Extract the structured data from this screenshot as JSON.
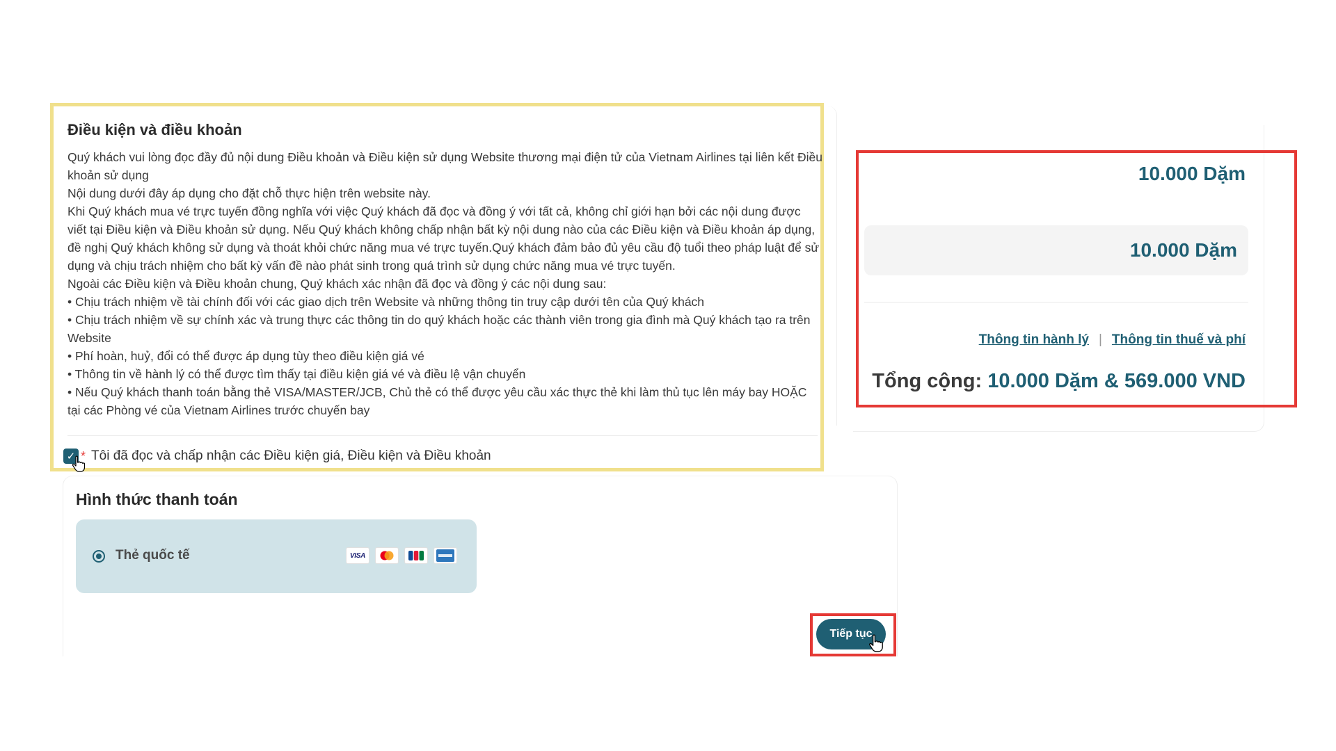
{
  "terms": {
    "title": "Điều kiện và điều khoản",
    "paragraphs": [
      "Quý khách vui lòng đọc đầy đủ nội dung Điều khoản và Điều kiện sử dụng Website thương mại điện tử của Vietnam Airlines tại liên kết Điều khoản sử dụng",
      "Nội dung dưới đây áp dụng cho đặt chỗ thực hiện trên website này.",
      "Khi Quý khách mua vé trực tuyến đồng nghĩa với việc Quý khách đã đọc và đồng ý với tất cả, không chỉ giới hạn bởi các nội dung được viết tại Điều kiện và Điều khoản sử dụng. Nếu Quý khách không chấp nhận bất kỳ nội dung nào của các Điều kiện và Điều khoản áp dụng, đề nghị Quý khách không sử dụng và thoát khỏi chức năng mua vé trực tuyến.Quý khách đảm bảo đủ yêu cầu độ tuổi theo pháp luật để sử dụng và chịu trách nhiệm cho bất kỳ vấn đề nào phát sinh trong quá trình sử dụng chức năng mua vé trực tuyến.",
      "Ngoài các Điều kiện và Điều khoản chung, Quý khách xác nhận đã đọc và đồng ý các nội dung sau:",
      "• Chịu trách nhiệm về tài chính đối với các giao dịch trên Website và những thông tin truy cập dưới tên của Quý khách",
      "• Chịu trách nhiệm về sự chính xác và trung thực các thông tin do quý khách hoặc các thành viên trong gia đình mà Quý khách tạo ra trên Website",
      "• Phí hoàn, huỷ, đổi có thể được áp dụng tùy theo điều kiện giá vé",
      "• Thông tin về hành lý có thể được tìm thấy tại điều kiện giá vé và điều lệ vận chuyển",
      "• Nếu Quý khách thanh toán bằng thẻ VISA/MASTER/JCB, Chủ thẻ có thể được yêu cầu xác thực thẻ khi làm thủ tục lên máy bay HOẶC tại các Phòng vé của Vietnam Airlines trước chuyến bay"
    ],
    "agree_checked": true,
    "required_mark": "*",
    "agree_label": "Tôi đã đọc và chấp nhận các Điều kiện giá, Điều kiện và Điều khoản",
    "check_glyph": "✓"
  },
  "payment": {
    "title": "Hình thức thanh toán",
    "option_label": "Thẻ quốc tế",
    "option_selected": true,
    "card_logos": [
      "visa-logo",
      "mastercard-logo",
      "jcb-logo",
      "amex-logo"
    ],
    "visa_text": "VISA",
    "continue_label": "Tiếp tục"
  },
  "summary": {
    "miles_line_1": "10.000 Dặm",
    "miles_line_2": "10.000 Dặm",
    "baggage_link": "Thông tin hành lý",
    "separator": "|",
    "tax_link": "Thông tin thuế và phí",
    "total_label": "Tổng cộng:",
    "total_value": "10.000 Dặm & 569.000 VND"
  },
  "colors": {
    "primary": "#1f5f73",
    "highlight_yellow": "#f0e08c",
    "highlight_red": "#e53935",
    "option_bg": "#d0e3e8"
  }
}
